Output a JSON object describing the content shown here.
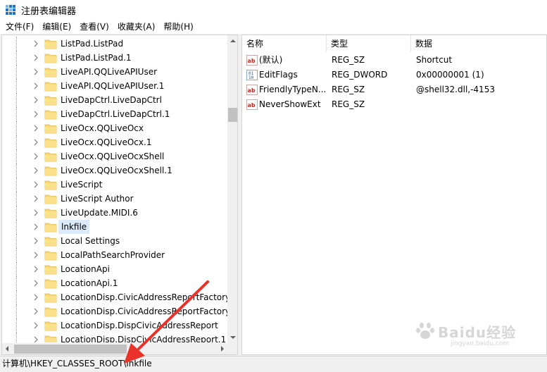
{
  "window": {
    "title": "注册表编辑器"
  },
  "menu": [
    {
      "label": "文件(F)"
    },
    {
      "label": "编辑(E)"
    },
    {
      "label": "查看(V)"
    },
    {
      "label": "收藏夹(A)"
    },
    {
      "label": "帮助(H)"
    }
  ],
  "tree": {
    "items": [
      {
        "label": "ListPad.ListPad",
        "selected": false
      },
      {
        "label": "ListPad.ListPad.1",
        "selected": false
      },
      {
        "label": "LiveAPI.QQLiveAPIUser",
        "selected": false
      },
      {
        "label": "LiveAPI.QQLiveAPIUser.1",
        "selected": false
      },
      {
        "label": "LiveDapCtrl.LiveDapCtrl",
        "selected": false
      },
      {
        "label": "LiveDapCtrl.LiveDapCtrl.1",
        "selected": false
      },
      {
        "label": "LiveOcx.QQLiveOcx",
        "selected": false
      },
      {
        "label": "LiveOcx.QQLiveOcx.1",
        "selected": false
      },
      {
        "label": "LiveOcx.QQLiveOcxShell",
        "selected": false
      },
      {
        "label": "LiveOcx.QQLiveOcxShell.1",
        "selected": false
      },
      {
        "label": "LiveScript",
        "selected": false
      },
      {
        "label": "LiveScript Author",
        "selected": false
      },
      {
        "label": "LiveUpdate.MIDI.6",
        "selected": false
      },
      {
        "label": "lnkfile",
        "selected": true
      },
      {
        "label": "Local Settings",
        "selected": false
      },
      {
        "label": "LocalPathSearchProvider",
        "selected": false
      },
      {
        "label": "LocationApi",
        "selected": false
      },
      {
        "label": "LocationApi.1",
        "selected": false
      },
      {
        "label": "LocationDisp.CivicAddressReportFactory",
        "selected": false
      },
      {
        "label": "LocationDisp.CivicAddressReportFactory.",
        "selected": false
      },
      {
        "label": "LocationDisp.DispCivicAddressReport",
        "selected": false
      },
      {
        "label": "LocationDisp.DispCivicAddressReport.1",
        "selected": false
      }
    ]
  },
  "values": {
    "columns": {
      "name": "名称",
      "type": "类型",
      "data": "数据"
    },
    "rows": [
      {
        "icon": "string-value-icon",
        "name": "(默认)",
        "type": "REG_SZ",
        "data": "Shortcut"
      },
      {
        "icon": "dword-value-icon",
        "name": "EditFlags",
        "type": "REG_DWORD",
        "data": "0x00000001 (1)"
      },
      {
        "icon": "string-value-icon",
        "name": "FriendlyTypeN...",
        "type": "REG_SZ",
        "data": "@shell32.dll,-4153"
      },
      {
        "icon": "string-value-icon",
        "name": "NeverShowExt",
        "type": "REG_SZ",
        "data": ""
      }
    ]
  },
  "status": {
    "path": "计算机\\HKEY_CLASSES_ROOT\\lnkfile"
  },
  "watermark": {
    "text": "Baidu经验",
    "sub": "jingyan.baidu.com"
  },
  "colors": {
    "accent": "#1e73c8",
    "selection": "#dcebfc",
    "annotation_arrow": "#e8322a",
    "folder": "#f8d775"
  }
}
